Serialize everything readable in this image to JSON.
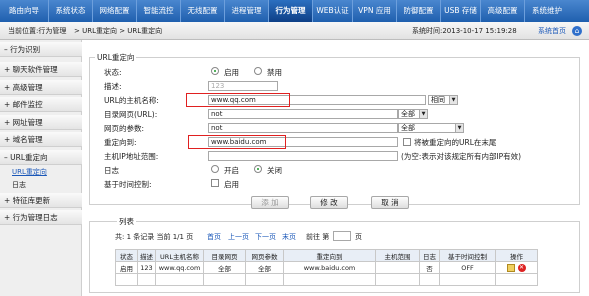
{
  "nav": {
    "items": [
      "路由向导",
      "系统状态",
      "网络配置",
      "智能流控",
      "无线配置",
      "进程管理",
      "行为管理",
      "WEB认证",
      "VPN 应用",
      "防御配置",
      "USB 存储",
      "高级配置",
      "系统维护"
    ],
    "active": "行为管理"
  },
  "header": {
    "location_label": "当前位置:行为管理",
    "breadcrumb": "> URL重定向 > URL重定向",
    "system_time": "系统时间:2013-10-17 15:19:28",
    "home_link": "系统首页"
  },
  "sidebar": {
    "items": [
      "行为识别",
      "聊天软件管理",
      "高级管理",
      "邮件监控",
      "网址管理",
      "域名管理",
      "URL重定向",
      "特征库更新",
      "行为管理日志"
    ],
    "sub_items": [
      "URL重定向",
      "日志"
    ]
  },
  "form": {
    "legend": "URL重定向",
    "state_label": "状态:",
    "enable_label": "启用",
    "disable_label": "禁用",
    "description_label": "描述:",
    "description_placeholder": "123",
    "host_label": "URL的主机名称:",
    "host_value": "www.qq.com",
    "host_match": "相同",
    "path_label": "目录网页(URL):",
    "path_value": "not",
    "path_match": "全部",
    "param_label": "网页的参数:",
    "param_value": "not",
    "param_match": "全部",
    "redirect_label": "重定向到:",
    "redirect_value": "www.baidu.com",
    "redirect_tail_label": "将被重定向的URL在末尾",
    "iprange_label": "主机IP地址范围:",
    "iprange_note": "(为空:表示对该规定所有内部IP有效)",
    "log_label": "日志",
    "log_on": "开启",
    "log_off": "关闭",
    "schedule_label": "基于时间控制:",
    "schedule_check": "启用",
    "buttons": {
      "add": "添 加",
      "edit": "修 改",
      "cancel": "取 消"
    }
  },
  "list": {
    "legend": "列表",
    "summary": "共: 1 条记录 当前 1/1 页",
    "first": "首页",
    "prev": "上一页",
    "next": "下一页",
    "last": "末页",
    "goto_label": "前往 第",
    "page_unit": "页",
    "columns": [
      "状态",
      "描述",
      "URL主机名称",
      "目录网页",
      "网页参数",
      "重定向到",
      "主机范围",
      "日志",
      "基于时间控制",
      "操作"
    ],
    "rows": [
      {
        "status": "启用",
        "desc": "123",
        "host": "www.qq.com",
        "dir": "全部",
        "param": "全部",
        "redirect": "www.baidu.com",
        "range": "",
        "log": "否",
        "schedule": "OFF"
      }
    ]
  },
  "colors": {
    "nav_bg": "#2b6fc0",
    "highlight": "#e02020",
    "link": "#1a57b8"
  }
}
